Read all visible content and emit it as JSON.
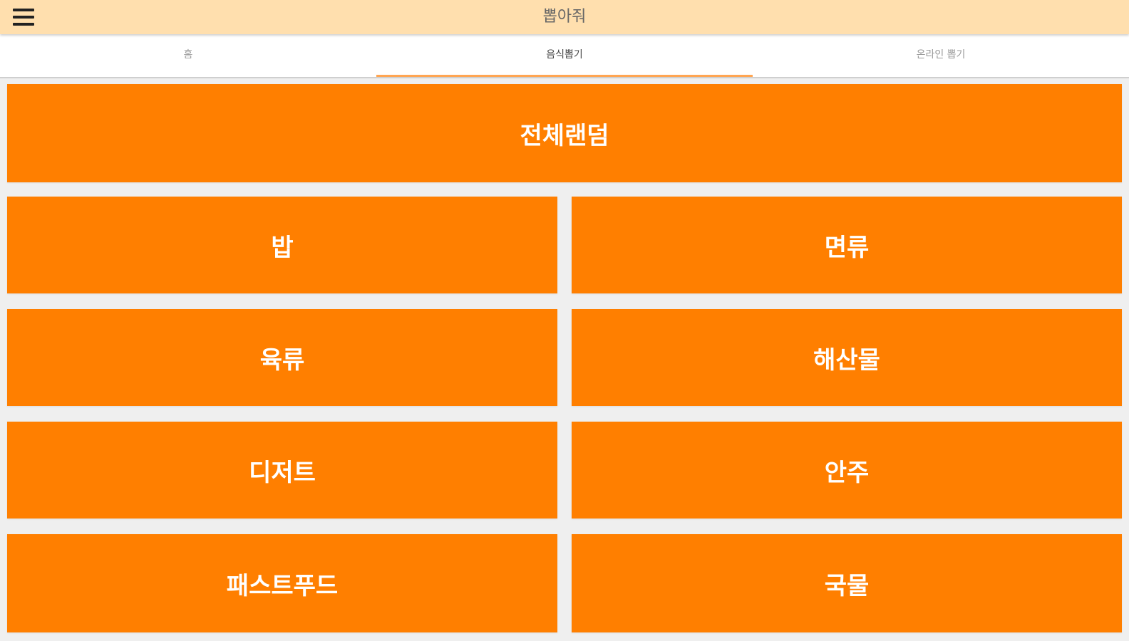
{
  "appbar": {
    "title": "뽑아줘",
    "menu_icon": "hamburger-menu-icon",
    "background": "#ffdfae"
  },
  "tabs": [
    {
      "label": "홈",
      "active": false
    },
    {
      "label": "음식뽑기",
      "active": true
    },
    {
      "label": "온라인 뽑기",
      "active": false
    }
  ],
  "colors": {
    "button": "#ff7f00",
    "tab_indicator": "#ffa552",
    "background": "#efefef"
  },
  "buttons": {
    "all_random": "전체랜덤",
    "rice": "밥",
    "noodles": "면류",
    "meat": "육류",
    "seafood": "해산물",
    "dessert": "디저트",
    "snacks": "안주",
    "fastfood": "패스트푸드",
    "soup": "국물"
  }
}
